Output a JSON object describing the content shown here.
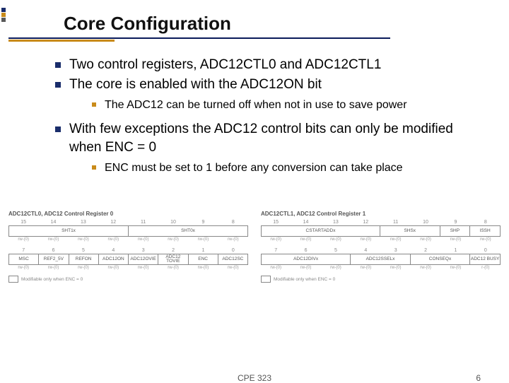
{
  "title": "Core Configuration",
  "bullets": {
    "b1": "Two control registers, ADC12CTL0 and ADC12CTL1",
    "b2": "The core is enabled with the ADC12ON bit",
    "b2a": "The ADC12 can be turned off when not in use to save power",
    "b3": "With few exceptions the ADC12 control bits can only be modified when ENC = 0",
    "b3a": "ENC must be set to 1 before any conversion can take place"
  },
  "reg0": {
    "title": "ADC12CTL0, ADC12 Control Register 0",
    "hi": {
      "bits": [
        "15",
        "14",
        "13",
        "12",
        "11",
        "10",
        "9",
        "8"
      ],
      "fields": [
        {
          "label": "SHT1x",
          "span": 4
        },
        {
          "label": "SHT0x",
          "span": 4
        }
      ],
      "rw": [
        "rw-(0)",
        "rw-(0)",
        "rw-(0)",
        "rw-(0)",
        "rw-(0)",
        "rw-(0)",
        "rw-(0)",
        "rw-(0)"
      ]
    },
    "lo": {
      "bits": [
        "7",
        "6",
        "5",
        "4",
        "3",
        "2",
        "1",
        "0"
      ],
      "fields": [
        {
          "label": "MSC",
          "span": 1
        },
        {
          "label": "REF2_5V",
          "span": 1
        },
        {
          "label": "REFON",
          "span": 1
        },
        {
          "label": "ADC12ON",
          "span": 1
        },
        {
          "label": "ADC12OVIE",
          "span": 1
        },
        {
          "label": "ADC12 TOVIE",
          "span": 1
        },
        {
          "label": "ENC",
          "span": 1
        },
        {
          "label": "ADC12SC",
          "span": 1
        }
      ],
      "rw": [
        "rw-(0)",
        "rw-(0)",
        "rw-(0)",
        "rw-(0)",
        "rw-(0)",
        "rw-(0)",
        "rw-(0)",
        "rw-(0)"
      ]
    },
    "legend": "Modifiable only when ENC = 0"
  },
  "reg1": {
    "title": "ADC12CTL1, ADC12 Control Register 1",
    "hi": {
      "bits": [
        "15",
        "14",
        "13",
        "12",
        "11",
        "10",
        "9",
        "8"
      ],
      "fields": [
        {
          "label": "CSTARTADDx",
          "span": 4
        },
        {
          "label": "SHSx",
          "span": 2
        },
        {
          "label": "SHP",
          "span": 1
        },
        {
          "label": "ISSH",
          "span": 1
        }
      ],
      "rw": [
        "rw-(0)",
        "rw-(0)",
        "rw-(0)",
        "rw-(0)",
        "rw-(0)",
        "rw-(0)",
        "rw-(0)",
        "rw-(0)"
      ]
    },
    "lo": {
      "bits": [
        "7",
        "6",
        "5",
        "4",
        "3",
        "2",
        "1",
        "0"
      ],
      "fields": [
        {
          "label": "ADC12DIVx",
          "span": 3
        },
        {
          "label": "ADC12SSELx",
          "span": 2
        },
        {
          "label": "CONSEQx",
          "span": 2
        },
        {
          "label": "ADC12 BUSY",
          "span": 1
        }
      ],
      "rw": [
        "rw-(0)",
        "rw-(0)",
        "rw-(0)",
        "rw-(0)",
        "rw-(0)",
        "rw-(0)",
        "rw-(0)",
        "r-(0)"
      ]
    },
    "legend": "Modifiable only when ENC = 0"
  },
  "footer": {
    "course": "CPE 323",
    "page": "6"
  }
}
